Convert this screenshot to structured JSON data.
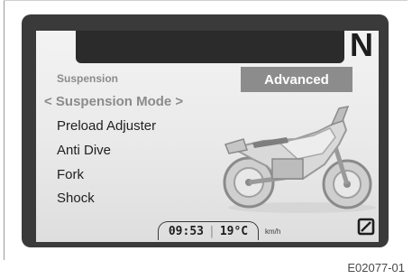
{
  "header": {
    "gear": "N"
  },
  "menu": {
    "title": "Suspension",
    "selected_item": "< Suspension Mode >",
    "items": [
      "Preload Adjuster",
      "Anti Dive",
      "Fork",
      "Shock"
    ]
  },
  "mode_button": {
    "label": "Advanced"
  },
  "status": {
    "time": "09:53",
    "separator": "|",
    "temperature": "19°C",
    "speed_unit": "km/h"
  },
  "caption": "E02077-01",
  "icons": {
    "motorcycle": "motorcycle-image",
    "speed": "zero-speed-icon"
  },
  "colors": {
    "bezel": "#3a3a3a",
    "screen": "#ececec",
    "button": "#8c8c8c"
  }
}
